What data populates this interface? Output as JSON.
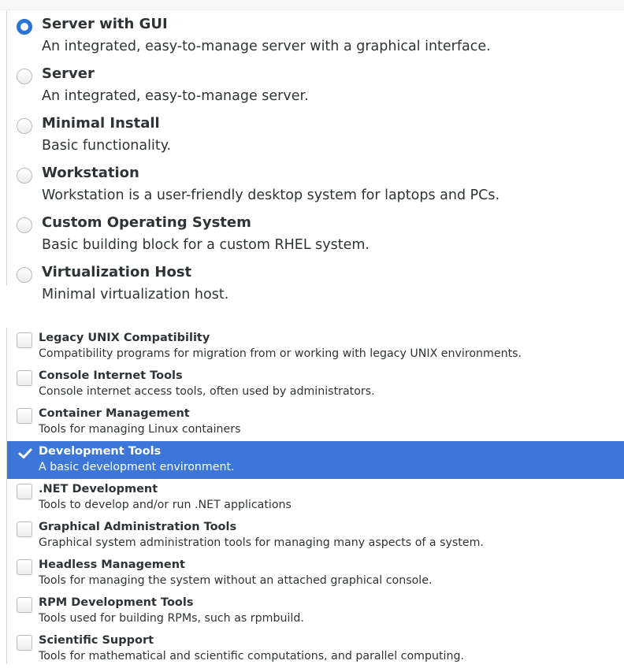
{
  "base_environments": [
    {
      "title": "Server with GUI",
      "description": "An integrated, easy-to-manage server with a graphical interface.",
      "selected": true
    },
    {
      "title": "Server",
      "description": "An integrated, easy-to-manage server.",
      "selected": false
    },
    {
      "title": "Minimal Install",
      "description": "Basic functionality.",
      "selected": false
    },
    {
      "title": "Workstation",
      "description": "Workstation is a user-friendly desktop system for laptops and PCs.",
      "selected": false
    },
    {
      "title": "Custom Operating System",
      "description": "Basic building block for a custom RHEL system.",
      "selected": false
    },
    {
      "title": "Virtualization Host",
      "description": "Minimal virtualization host.",
      "selected": false
    }
  ],
  "additional_software": [
    {
      "title": "Legacy UNIX Compatibility",
      "description": "Compatibility programs for migration from or working with legacy UNIX environments.",
      "checked": false
    },
    {
      "title": "Console Internet Tools",
      "description": "Console internet access tools, often used by administrators.",
      "checked": false
    },
    {
      "title": "Container Management",
      "description": "Tools for managing Linux containers",
      "checked": false
    },
    {
      "title": "Development Tools",
      "description": "A basic development environment.",
      "checked": true
    },
    {
      "title": ".NET Development",
      "description": "Tools to develop and/or run .NET applications",
      "checked": false
    },
    {
      "title": "Graphical Administration Tools",
      "description": "Graphical system administration tools for managing many aspects of a system.",
      "checked": false
    },
    {
      "title": "Headless Management",
      "description": "Tools for managing the system without an attached graphical console.",
      "checked": false
    },
    {
      "title": "RPM Development Tools",
      "description": "Tools used for building RPMs, such as rpmbuild.",
      "checked": false
    },
    {
      "title": "Scientific Support",
      "description": "Tools for mathematical and scientific computations, and parallel computing.",
      "checked": false
    }
  ],
  "colors": {
    "selection": "#3b76d8",
    "radio_accent": "#2b73d6",
    "text": "#2e3436"
  },
  "icons": {
    "check": "checkmark-icon"
  }
}
